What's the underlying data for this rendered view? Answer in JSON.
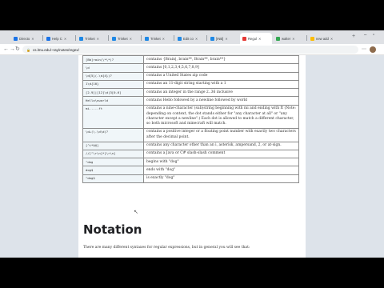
{
  "browser": {
    "tabs": [
      {
        "label": "Directo",
        "color": "#1a73e8"
      },
      {
        "label": "Help C",
        "color": "#1a73e8"
      },
      {
        "label": "Trinket",
        "color": "#1e88e5"
      },
      {
        "label": "Trinket",
        "color": "#1e88e5"
      },
      {
        "label": "Trinket",
        "color": "#1e88e5"
      },
      {
        "label": "Edit co",
        "color": "#1e88e5"
      },
      {
        "label": "[INB]",
        "color": "#1e88e5"
      },
      {
        "label": "Regul",
        "color": "#e53935"
      },
      {
        "label": "walter",
        "color": "#34a853"
      },
      {
        "label": "new add",
        "color": "#fbbc04"
      }
    ],
    "url": "cs.lmu.edu/~ray/notes/regex/"
  },
  "table": {
    "rows": [
      {
        "pattern": "[Bb]rain(\\*\\*)?",
        "desc": "contains {Brain|, brain**, Brain**, brain**}"
      },
      {
        "pattern": "\\d",
        "desc": "contains [0,1,2,3,4,5,6,7,8,9]"
      },
      {
        "pattern": "\\d{5}(-\\d{4})?",
        "desc": "contains a United States zip code"
      },
      {
        "pattern": "1\\d{10}",
        "desc": "contains an 11-digit string starting with a 1"
      },
      {
        "pattern": "[2-9]|[12]\\d|3[0-6]",
        "desc": "contains an integer in the range 2..36 inclusive"
      },
      {
        "pattern": "Hello\\nworld",
        "desc": "contains Hello followed by a newline followed by world"
      },
      {
        "pattern": "mi.....ft",
        "desc": "contains a nine-character (sub)string beginning with mi and ending with ft (Note: depending on context, the dot stands either for \"any character at all\" or \"any character except a newline\".) Each dot is allowed to match a different character, so both microsoft and minecraft will match."
      },
      {
        "pattern": "\\d+(\\.\\d\\d)?",
        "desc": "contains a positive integer or a floating point number with exactly two characters after the decimal point."
      },
      {
        "pattern": "[^i*&@]",
        "desc": "contains any character other than an i, asterisk, ampersand, 2, or at-sign."
      },
      {
        "pattern": "//[^\\r\\n]*[\\r\\n]",
        "desc": "contains a Java or C# slash-slash comment"
      },
      {
        "pattern": "^dog",
        "desc": "begins with \"dog\""
      },
      {
        "pattern": "dog$",
        "desc": "ends with \"dog\""
      },
      {
        "pattern": "^dog$",
        "desc": "is exactly \"dog\""
      }
    ]
  },
  "section": {
    "heading": "Notation",
    "intro": "There are many different syntaxes for regular expressions, but in general you will see that:"
  }
}
